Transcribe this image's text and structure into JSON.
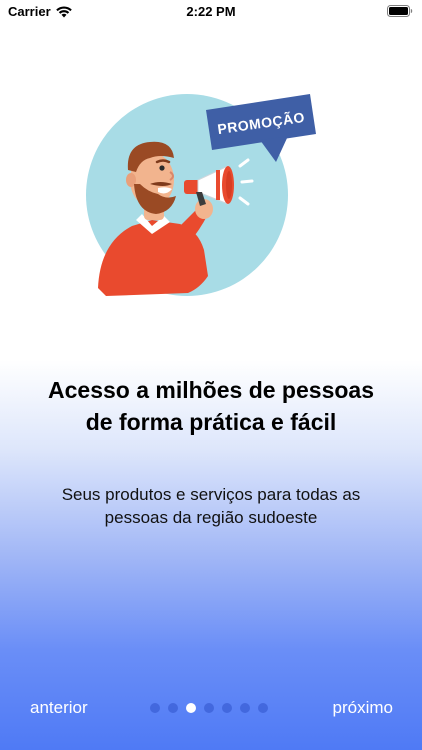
{
  "status_bar": {
    "carrier": "Carrier",
    "time": "2:22 PM"
  },
  "illustration": {
    "sign_text": "PROMOÇÃO"
  },
  "content": {
    "headline": "Acesso a milhões de pessoas de forma prática e fácil",
    "subtitle": "Seus produtos e serviços para todas as pessoas da região sudoeste"
  },
  "navigation": {
    "prev_label": "anterior",
    "next_label": "próximo",
    "page_count": 7,
    "current_page": 3
  },
  "colors": {
    "accent_blue": "#4f7af5",
    "circle": "#a8dce6",
    "shirt": "#e94a2e",
    "sign": "#3f5fa6"
  }
}
